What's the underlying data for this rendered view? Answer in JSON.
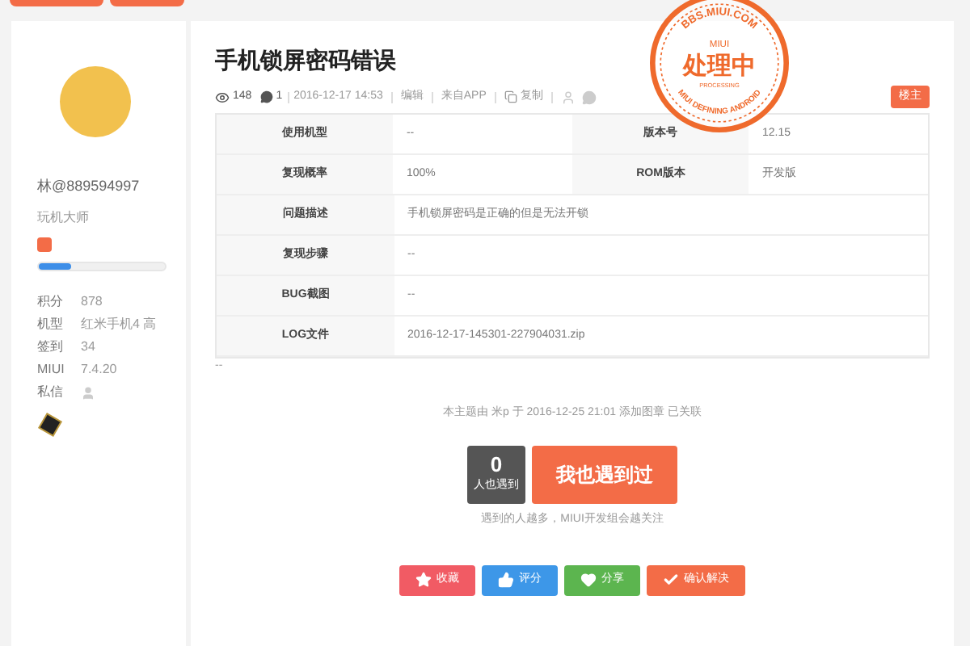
{
  "user": {
    "name": "林@889594997",
    "rank": "玩机大师",
    "progress": {
      "level": 0.25
    },
    "stats": [
      {
        "label": "积分",
        "value": "878"
      },
      {
        "label": "机型",
        "value": "红米手机4 高"
      },
      {
        "label": "签到",
        "value": "34"
      },
      {
        "label": "MIUI",
        "value": "7.4.20"
      },
      {
        "label": "私信",
        "kind": "icon"
      }
    ]
  },
  "post": {
    "title": "手机锁屏密码错误",
    "views": "148",
    "replies": "1",
    "date": "2016-12-17 14:53",
    "edit": "编辑",
    "source": "来自APP",
    "copy": "复制",
    "owner_badge": "楼主",
    "stamp": {
      "site": "BBS.MIUI.COM",
      "brand": "MIUI",
      "status": "处理中",
      "status_en": "PROCESSING",
      "slogan": "MIUI DEFINING ANDROID"
    },
    "table": [
      {
        "cells": [
          {
            "label": "使用机型",
            "value": "--"
          },
          {
            "label": "版本号",
            "value": "12.15"
          }
        ]
      },
      {
        "cells": [
          {
            "label": "复现概率",
            "value": "100%"
          },
          {
            "label": "ROM版本",
            "value": "开发版"
          }
        ]
      },
      {
        "cells": [
          {
            "label": "问题描述",
            "value": "手机锁屏密码是正确的但是无法开锁"
          }
        ]
      },
      {
        "cells": [
          {
            "label": "复现步骤",
            "value": "--"
          }
        ]
      },
      {
        "cells": [
          {
            "label": "BUG截图",
            "value": "--"
          }
        ]
      },
      {
        "cells": [
          {
            "label": "LOG文件",
            "value": "2016-12-17-145301-227904031.zip"
          }
        ]
      }
    ],
    "after_table": "--",
    "notice": "本主题由 米p 于 2016-12-25 21:01 添加图章 已关联",
    "count": "0",
    "count_label": "人也遇到",
    "me_too": "我也遇到过",
    "hint": "遇到的人越多，MIUI开发组会越关注",
    "actions": [
      {
        "kind": "favorite",
        "label": "收藏",
        "color": "#f15b64"
      },
      {
        "kind": "rate",
        "label": "评分",
        "color": "#3d97e8"
      },
      {
        "kind": "share",
        "label": "分享",
        "color": "#5cb54f"
      },
      {
        "kind": "resolve",
        "label": "确认解决",
        "color": "#f36c47"
      }
    ]
  }
}
